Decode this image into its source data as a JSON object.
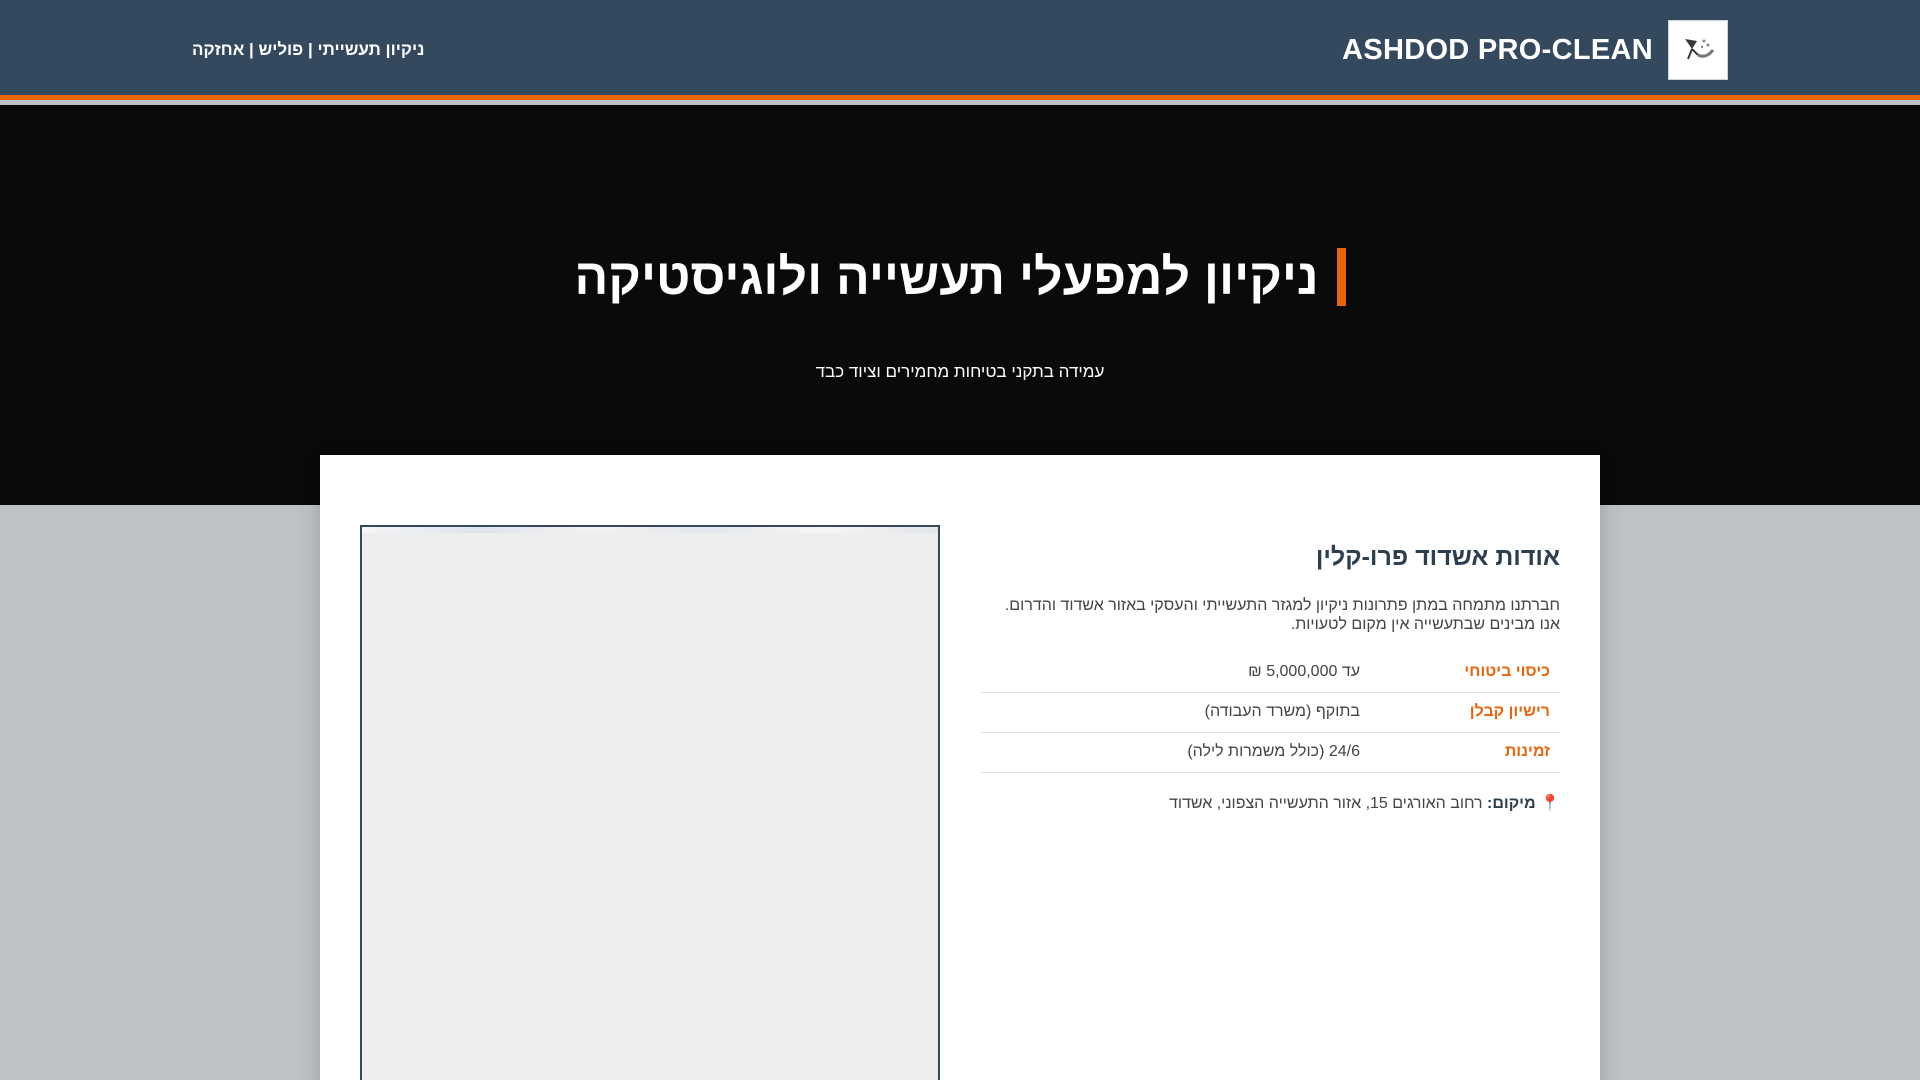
{
  "header": {
    "brand_name": "ASHDOD PRO-CLEAN",
    "logo_icon": "cleaning-logo-icon",
    "tagline": "ניקיון תעשייתי | פוליש | אחזקה"
  },
  "hero": {
    "title": "ניקיון למפעלי תעשייה ולוגיסטיקה",
    "subtitle": "עמידה בתקני בטיחות מחמירים וציוד כבד"
  },
  "about": {
    "title": "אודות אשדוד פרו-קלין",
    "text_line1": "חברתנו מתמחה במתן פתרונות ניקיון למגזר התעשייתי והעסקי באזור אשדוד והדרום.",
    "text_line2": "אנו מבינים שבתעשייה אין מקום לטעויות.",
    "rows": [
      {
        "label": "כיסוי ביטוחי",
        "value": "עד 5,000,000 ₪"
      },
      {
        "label": "רישיון קבלן",
        "value": "בתוקף (משרד העבודה)"
      },
      {
        "label": "זמינות",
        "value": "24/6 (כולל משמרות לילה)"
      }
    ],
    "location_icon": "map-pin-icon",
    "location_pin": "📍",
    "location_label": "מיקום:",
    "location_value": "רחוב האורגים 15, אזור התעשייה הצפוני, אשדוד"
  },
  "colors": {
    "header_bg": "#34495e",
    "accent": "#e8650d",
    "hero_bg": "#0a0a0a",
    "page_bg": "#bdc2c6"
  }
}
